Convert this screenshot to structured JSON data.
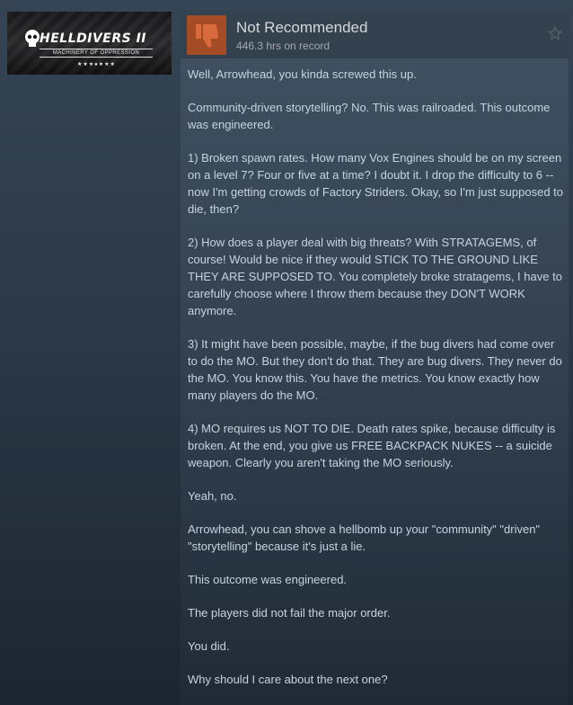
{
  "game": {
    "title": "HELLDIVERS II",
    "subtitle": "MACHINERY OF OPPRESSION",
    "stars": "★★★●★★★"
  },
  "review": {
    "recommendation": "Not Recommended",
    "hours": "446.3 hrs on record",
    "colors": {
      "thumb_bg": "#a34c25",
      "thumb_icon": "#d96a3c"
    },
    "paragraphs": [
      "Well, Arrowhead, you kinda screwed this up.",
      "Community-driven storytelling? No. This was railroaded. This outcome was engineered.",
      "1) Broken spawn rates. How many Vox Engines should be on my screen on a level 7? Four or five at a time? I doubt it. I drop the difficulty to 6 -- now I'm getting crowds of Factory Striders. Okay, so I'm just supposed to die, then?",
      "2) How does a player deal with big threats? With STRATAGEMS, of course! Would be nice if they would STICK TO THE GROUND LIKE THEY ARE SUPPOSED TO. You completely broke stratagems, I have to carefully choose where I throw them because they DON'T WORK anymore.",
      "3) It might have been possible, maybe, if the bug divers had come over to do the MO. But they don't do that. They are bug divers. They never do the MO. You know this. You have the metrics. You know exactly how many players do the MO.",
      "4) MO requires us NOT TO DIE. Death rates spike, because difficulty is broken. At the end, you give us FREE BACKPACK NUKES -- a suicide weapon. Clearly you aren't taking the MO seriously.",
      "Yeah, no.",
      "Arrowhead, you can shove a hellbomb up your \"community\" \"driven\" \"storytelling\" because it's just a lie.",
      "This outcome was engineered.",
      "The players did not fail the major order.",
      "You did.",
      "Why should I care about the next one?"
    ]
  }
}
